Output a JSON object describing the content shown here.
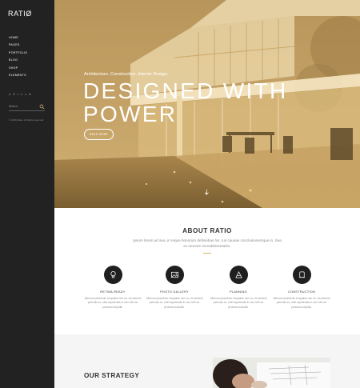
{
  "brand": {
    "logo": "RATIØ"
  },
  "nav": {
    "items": [
      "HOME",
      "PAGES",
      "PORTFOLIO",
      "BLOG",
      "SHOP",
      "ELEMENTS"
    ]
  },
  "socials": [
    "a",
    "б",
    "t",
    "ʋ",
    "з",
    "in"
  ],
  "search": {
    "label": "Search"
  },
  "copyright": "© 2016 Ratio. All rights reserved.",
  "hero": {
    "eyebrow": "Architecture. Construction. Interior Design.",
    "title": "DESIGNED WITH POWER",
    "button": "READ MORE"
  },
  "about": {
    "title": "ABOUT RATIO",
    "text": "Ipsum lorem ad sea, in reque bonorum definiebas his. Ius causae conclusionemque in. Sea ex nemore ennoddimsetatim.",
    "features": [
      {
        "icon": "lightbulb-icon",
        "title": "RETINA READY",
        "desc": "Alienum phaedrum torquatos nec eu, vis detraxit periculis ex, nihil expetendis in mei. Mei an pericula euripidis."
      },
      {
        "icon": "photo-icon",
        "title": "PHOTO GALLERY",
        "desc": "Alienum phaedrum torquatos nec eu, vis detraxit periculis ex, nihil expetendis in mei. Mei an pericula euripidis."
      },
      {
        "icon": "compass-icon",
        "title": "PLANNING",
        "desc": "Alienum phaedrum torquatos nec eu, vis detraxit periculis ex, nihil expetendis in mei. Mei an pericula euripidis."
      },
      {
        "icon": "helmet-icon",
        "title": "CONSTRUCTION",
        "desc": "Alienum phaedrum torquatos nec eu, vis detraxit periculis ex, nihil expetendis in mei. Mei an pericula euripidis."
      }
    ]
  },
  "strategy": {
    "title": "OUR STRATEGY"
  },
  "colors": {
    "accent": "#d9b36c",
    "sidebar": "#222222",
    "hero_tint": "#c9a769",
    "dark_circle": "#1f1f1f"
  }
}
